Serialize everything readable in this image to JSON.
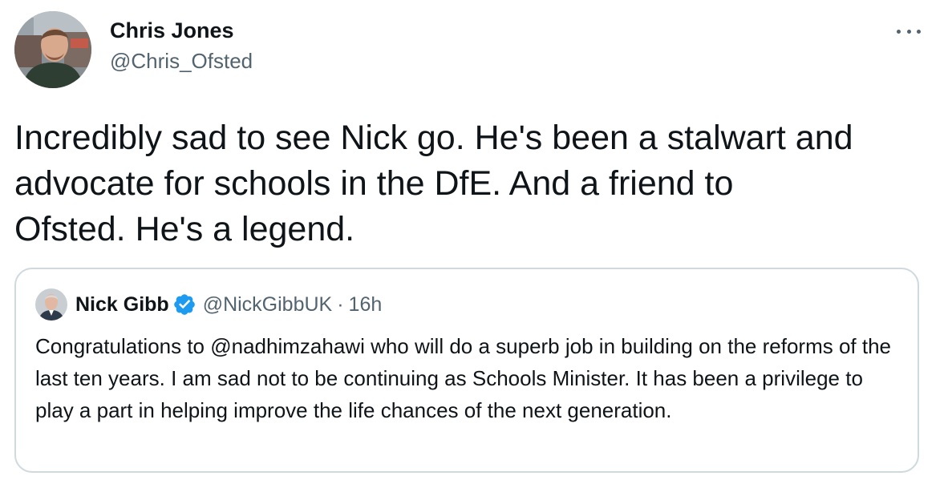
{
  "author": {
    "display_name": "Chris Jones",
    "handle": "@Chris_Ofsted",
    "avatar_icon": "profile-photo"
  },
  "more_icon": "ellipsis-icon",
  "tweet": {
    "text": "Incredibly sad to see Nick go. He's been a stalwart and\nadvocate for schools in the DfE. And a friend to\nOfsted. He's a legend."
  },
  "quoted_tweet": {
    "display_name": "Nick Gibb",
    "verified_icon": "verified-badge-icon",
    "handle": "@NickGibbUK",
    "separator": "·",
    "time": "16h",
    "text": "Congratulations to @nadhimzahawi who will do a superb job in building on the reforms of the last ten years. I am sad not to be continuing as Schools Minister. It has been a privilege to play a part in helping improve the life chances of the next generation."
  },
  "colors": {
    "text_primary": "#0f1419",
    "text_secondary": "#536471",
    "border": "#cfd9de",
    "verified_blue": "#1d9bf0"
  }
}
